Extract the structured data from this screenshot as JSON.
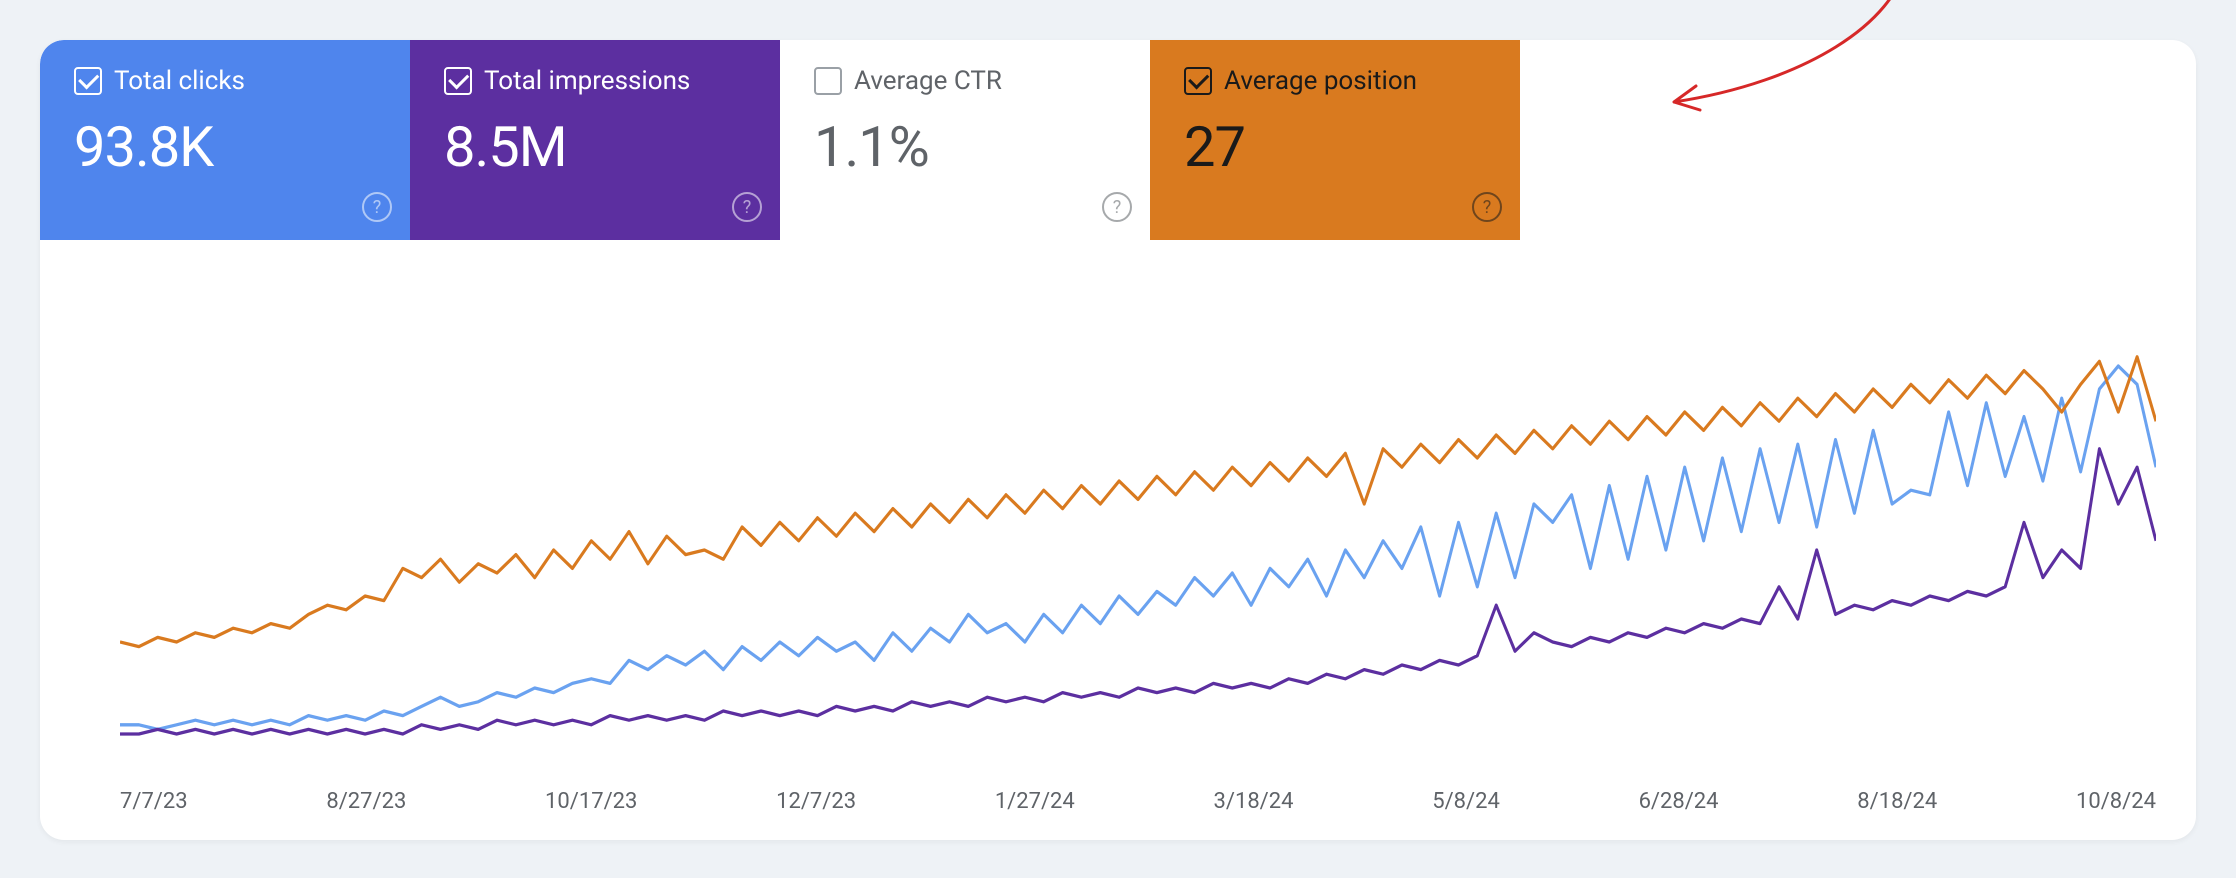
{
  "metrics": {
    "clicks": {
      "label": "Total clicks",
      "value": "93.8K",
      "checked": true
    },
    "impressions": {
      "label": "Total impressions",
      "value": "8.5M",
      "checked": true
    },
    "ctr": {
      "label": "Average CTR",
      "value": "1.1%",
      "checked": false
    },
    "position": {
      "label": "Average position",
      "value": "27",
      "checked": true
    }
  },
  "colors": {
    "clicks": "#6aa2f0",
    "impressions": "#5c2fa0",
    "position": "#d97a1f",
    "arrow": "#d62828"
  },
  "chart_data": {
    "type": "line",
    "xlabel": "",
    "ylabel": "",
    "x_ticks": [
      "7/7/23",
      "8/27/23",
      "10/17/23",
      "12/7/23",
      "1/27/24",
      "3/18/24",
      "5/8/24",
      "6/28/24",
      "8/18/24",
      "10/8/24"
    ],
    "series": [
      {
        "name": "Total clicks",
        "color": "#6aa2f0",
        "values": [
          12,
          12,
          11,
          12,
          13,
          12,
          13,
          12,
          13,
          12,
          14,
          13,
          14,
          13,
          15,
          14,
          16,
          18,
          16,
          17,
          19,
          18,
          20,
          19,
          21,
          22,
          21,
          26,
          24,
          27,
          25,
          28,
          24,
          29,
          26,
          30,
          27,
          31,
          28,
          30,
          26,
          32,
          28,
          33,
          30,
          36,
          32,
          34,
          30,
          36,
          32,
          38,
          34,
          40,
          36,
          41,
          38,
          44,
          40,
          45,
          38,
          46,
          42,
          48,
          40,
          50,
          44,
          52,
          46,
          55,
          40,
          56,
          42,
          58,
          44,
          60,
          56,
          62,
          46,
          64,
          48,
          66,
          50,
          68,
          52,
          70,
          54,
          72,
          56,
          73,
          55,
          74,
          58,
          76,
          60,
          63,
          62,
          80,
          64,
          82,
          66,
          79,
          65,
          83,
          67,
          85,
          90,
          86,
          68
        ]
      },
      {
        "name": "Total impressions",
        "color": "#5c2fa0",
        "values": [
          10,
          10,
          11,
          10,
          11,
          10,
          11,
          10,
          11,
          10,
          11,
          10,
          11,
          10,
          11,
          10,
          12,
          11,
          12,
          11,
          13,
          12,
          13,
          12,
          13,
          12,
          14,
          13,
          14,
          13,
          14,
          13,
          15,
          14,
          15,
          14,
          15,
          14,
          16,
          15,
          16,
          15,
          17,
          16,
          17,
          16,
          18,
          17,
          18,
          17,
          19,
          18,
          19,
          18,
          20,
          19,
          20,
          19,
          21,
          20,
          21,
          20,
          22,
          21,
          23,
          22,
          24,
          23,
          25,
          24,
          26,
          25,
          27,
          38,
          28,
          32,
          30,
          29,
          31,
          30,
          32,
          31,
          33,
          32,
          34,
          33,
          35,
          34,
          42,
          35,
          50,
          36,
          38,
          37,
          39,
          38,
          40,
          39,
          41,
          40,
          42,
          56,
          44,
          50,
          46,
          72,
          60,
          68,
          52
        ]
      },
      {
        "name": "Average position",
        "color": "#d97a1f",
        "values": [
          30,
          29,
          31,
          30,
          32,
          31,
          33,
          32,
          34,
          33,
          36,
          38,
          37,
          40,
          39,
          46,
          44,
          48,
          43,
          47,
          45,
          49,
          44,
          50,
          46,
          52,
          48,
          54,
          47,
          53,
          49,
          50,
          48,
          55,
          51,
          56,
          52,
          57,
          53,
          58,
          54,
          59,
          55,
          60,
          56,
          61,
          57,
          62,
          58,
          63,
          59,
          64,
          60,
          65,
          61,
          66,
          62,
          67,
          63,
          68,
          64,
          69,
          65,
          70,
          66,
          71,
          60,
          72,
          68,
          73,
          69,
          74,
          70,
          75,
          71,
          76,
          72,
          77,
          73,
          78,
          74,
          79,
          75,
          80,
          76,
          81,
          77,
          82,
          78,
          83,
          79,
          84,
          80,
          85,
          81,
          86,
          82,
          87,
          83,
          88,
          84,
          89,
          85,
          80,
          86,
          91,
          80,
          92,
          78
        ]
      }
    ],
    "ylim_relative": [
      0,
      100
    ]
  }
}
